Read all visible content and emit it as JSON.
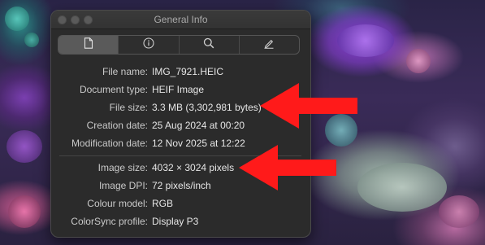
{
  "window": {
    "title": "General Info"
  },
  "tabs": [
    {
      "name": "general",
      "icon": "document-icon",
      "selected": true
    },
    {
      "name": "more-info",
      "icon": "info-icon",
      "selected": false
    },
    {
      "name": "search",
      "icon": "search-icon",
      "selected": false
    },
    {
      "name": "edit",
      "icon": "pencil-icon",
      "selected": false
    }
  ],
  "info": {
    "file_name": {
      "label": "File name:",
      "value": "IMG_7921.HEIC"
    },
    "document_type": {
      "label": "Document type:",
      "value": "HEIF Image"
    },
    "file_size": {
      "label": "File size:",
      "value": "3.3 MB (3,302,981 bytes)"
    },
    "creation_date": {
      "label": "Creation date:",
      "value": "25 Aug 2024 at 00:20"
    },
    "modification_date": {
      "label": "Modification date:",
      "value": "12 Nov 2025 at 12:22"
    },
    "image_size": {
      "label": "Image size:",
      "value": "4032 × 3024 pixels"
    },
    "image_dpi": {
      "label": "Image DPI:",
      "value": "72 pixels/inch"
    },
    "colour_model": {
      "label": "Colour model:",
      "value": "RGB"
    },
    "colorsync_profile": {
      "label": "ColorSync profile:",
      "value": "Display P3"
    }
  },
  "colors": {
    "arrow": "#ff1a1a",
    "window_bg": "#2b2b2b",
    "selected_tab": "#5a5a5a"
  }
}
